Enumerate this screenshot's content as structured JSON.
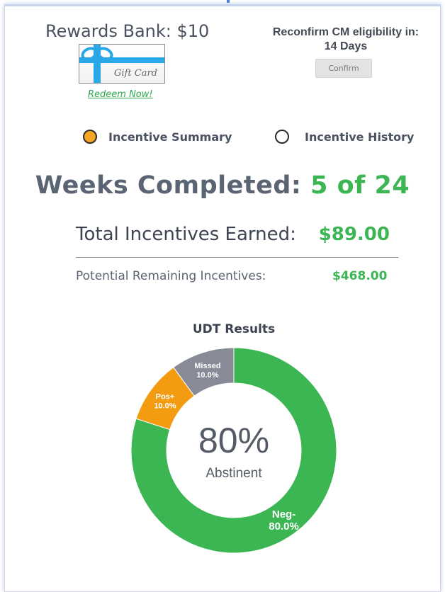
{
  "rewards": {
    "title": "Rewards Bank: $10",
    "gift_card_text": "Gift Card",
    "redeem_label": "Redeem Now!"
  },
  "eligibility": {
    "line1": "Reconfirm CM eligibility in:",
    "line2": "14 Days",
    "confirm_label": "Confirm"
  },
  "tabs": [
    {
      "label": "Incentive Summary",
      "selected": true
    },
    {
      "label": "Incentive History",
      "selected": false
    }
  ],
  "weeks": {
    "label": "Weeks Completed:",
    "value": "5 of 24"
  },
  "totals": {
    "earned_label": "Total Incentives Earned:",
    "earned_value": "$89.00",
    "remaining_label": "Potential Remaining Incentives:",
    "remaining_value": "$468.00"
  },
  "chart_data": {
    "type": "pie",
    "title": "UDT Results",
    "center_value": "80%",
    "center_label": "Abstinent",
    "slices": [
      {
        "label": "Neg-",
        "value": 80.0,
        "display": "80.0%",
        "color": "#3cb653"
      },
      {
        "label": "Pos+",
        "value": 10.0,
        "display": "10.0%",
        "color": "#f39c12"
      },
      {
        "label": "Missed",
        "value": 10.0,
        "display": "10.0%",
        "color": "#878b97"
      }
    ]
  },
  "colors": {
    "accent_green": "#3cb653",
    "radio_selected": "#f5a623"
  }
}
